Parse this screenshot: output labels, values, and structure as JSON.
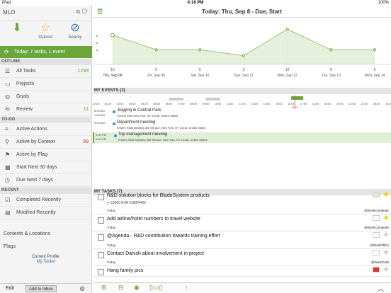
{
  "status": {
    "carrier": "iPad",
    "time": "4:18 PM",
    "battery": "100%"
  },
  "sidebar": {
    "title": "MLO",
    "quick": [
      {
        "label": "",
        "icon": "download-inbox-icon"
      },
      {
        "label": "Starred",
        "icon": "star-icon"
      },
      {
        "label": "Nearby",
        "icon": "compass-icon"
      }
    ],
    "today_label": "Today: 7 tasks, 1 event",
    "outline_header": "OUTLINE",
    "outline": [
      {
        "label": "All Tasks",
        "count": "1299"
      },
      {
        "label": "Projects",
        "count": ""
      },
      {
        "label": "Goals",
        "count": ""
      },
      {
        "label": "Review",
        "count": "11"
      }
    ],
    "todo_header": "TO-DO",
    "todo": [
      {
        "label": "Active Actions",
        "count": ""
      },
      {
        "label": "Active by Context",
        "count": "99"
      },
      {
        "label": "Active by Flag",
        "count": ""
      },
      {
        "label": "Start Next 30 days",
        "count": ""
      },
      {
        "label": "Due Next 7 days",
        "count": ""
      }
    ],
    "recent_header": "RECENT",
    "recent": [
      {
        "label": "Completed Recently",
        "count": ""
      },
      {
        "label": "Modified Recently",
        "count": ""
      }
    ],
    "contexts": "Contexts & Locations",
    "flags": "Flags",
    "profile_label": "Current Profile:",
    "profile_value": "My Tasks!",
    "edit": "Edit",
    "add_inbox": "Add to Inbox"
  },
  "main": {
    "title": "Today: Thu, Sep 8 - Due, Start",
    "events_header": "MY EVENTS (3)",
    "tasks_header": "MY TASKS (7)",
    "timeline_hours": [
      "00:00",
      "01:00",
      "02:00",
      "03:00",
      "04:00",
      "05:00",
      "06:00",
      "07:00",
      "08:00",
      "09:00",
      "10:00",
      "11:00",
      "12:00",
      "13:00",
      "14:00",
      "15:00",
      "16:00",
      "17:00",
      "18:00",
      "19:00",
      "20:00",
      "21:00",
      "22:00",
      "23:00",
      "24:00"
    ],
    "now_label": "16:18",
    "events": [
      {
        "time": "6:00 AM",
        "time2": "7:00 AM",
        "name": "Jogging in Central Park",
        "addr": "Central Park New York, NY 10028, United States"
      },
      {
        "time": "9:00 AM",
        "time2": "",
        "name": "Department meeting",
        "addr": "Empire State Building 350 5th Ave, New York, NY 10118, United States"
      },
      {
        "time": "4:00 PM",
        "time2": "5:00 PM",
        "name": "Top management meeting",
        "addr": "Empire State Building 350 5th Ave, New York, NY 10118, United States"
      }
    ],
    "tasks": [
      {
        "title": "R&D solution blocks for BladeSystem products",
        "sub": "C3000 EVA 4100/4400",
        "due": "Today",
        "ctx": "@WorkComputer"
      },
      {
        "title": "Add airline/hotel numbers to travel website",
        "sub": "",
        "due": "Today",
        "ctx": "@WorkComputer"
      },
      {
        "title": "@Agenda - R&D contribution towards training effort",
        "sub": "",
        "due": "Today",
        "ctx": "@WorkOffice"
      },
      {
        "title": "Contact Danish about involvement in project",
        "sub": "",
        "due": "Today",
        "ctx": "@WorkCalls"
      },
      {
        "title": "Hang family pics",
        "sub": "",
        "due": "",
        "ctx": ""
      }
    ]
  },
  "chart_data": {
    "type": "area",
    "categories": [
      "Thu, Sep 08",
      "Fri, Sep 09",
      "Sat, Sep 10",
      "Sun, Sep 11",
      "Mon, Sep 12",
      "Tue, Sep 13",
      "Wed, Sep 14"
    ],
    "values": [
      10,
      5,
      5,
      3,
      12,
      5,
      5
    ],
    "ylim": [
      0,
      14
    ],
    "color": "#6aa73a",
    "fill": "#e6f0dc"
  }
}
